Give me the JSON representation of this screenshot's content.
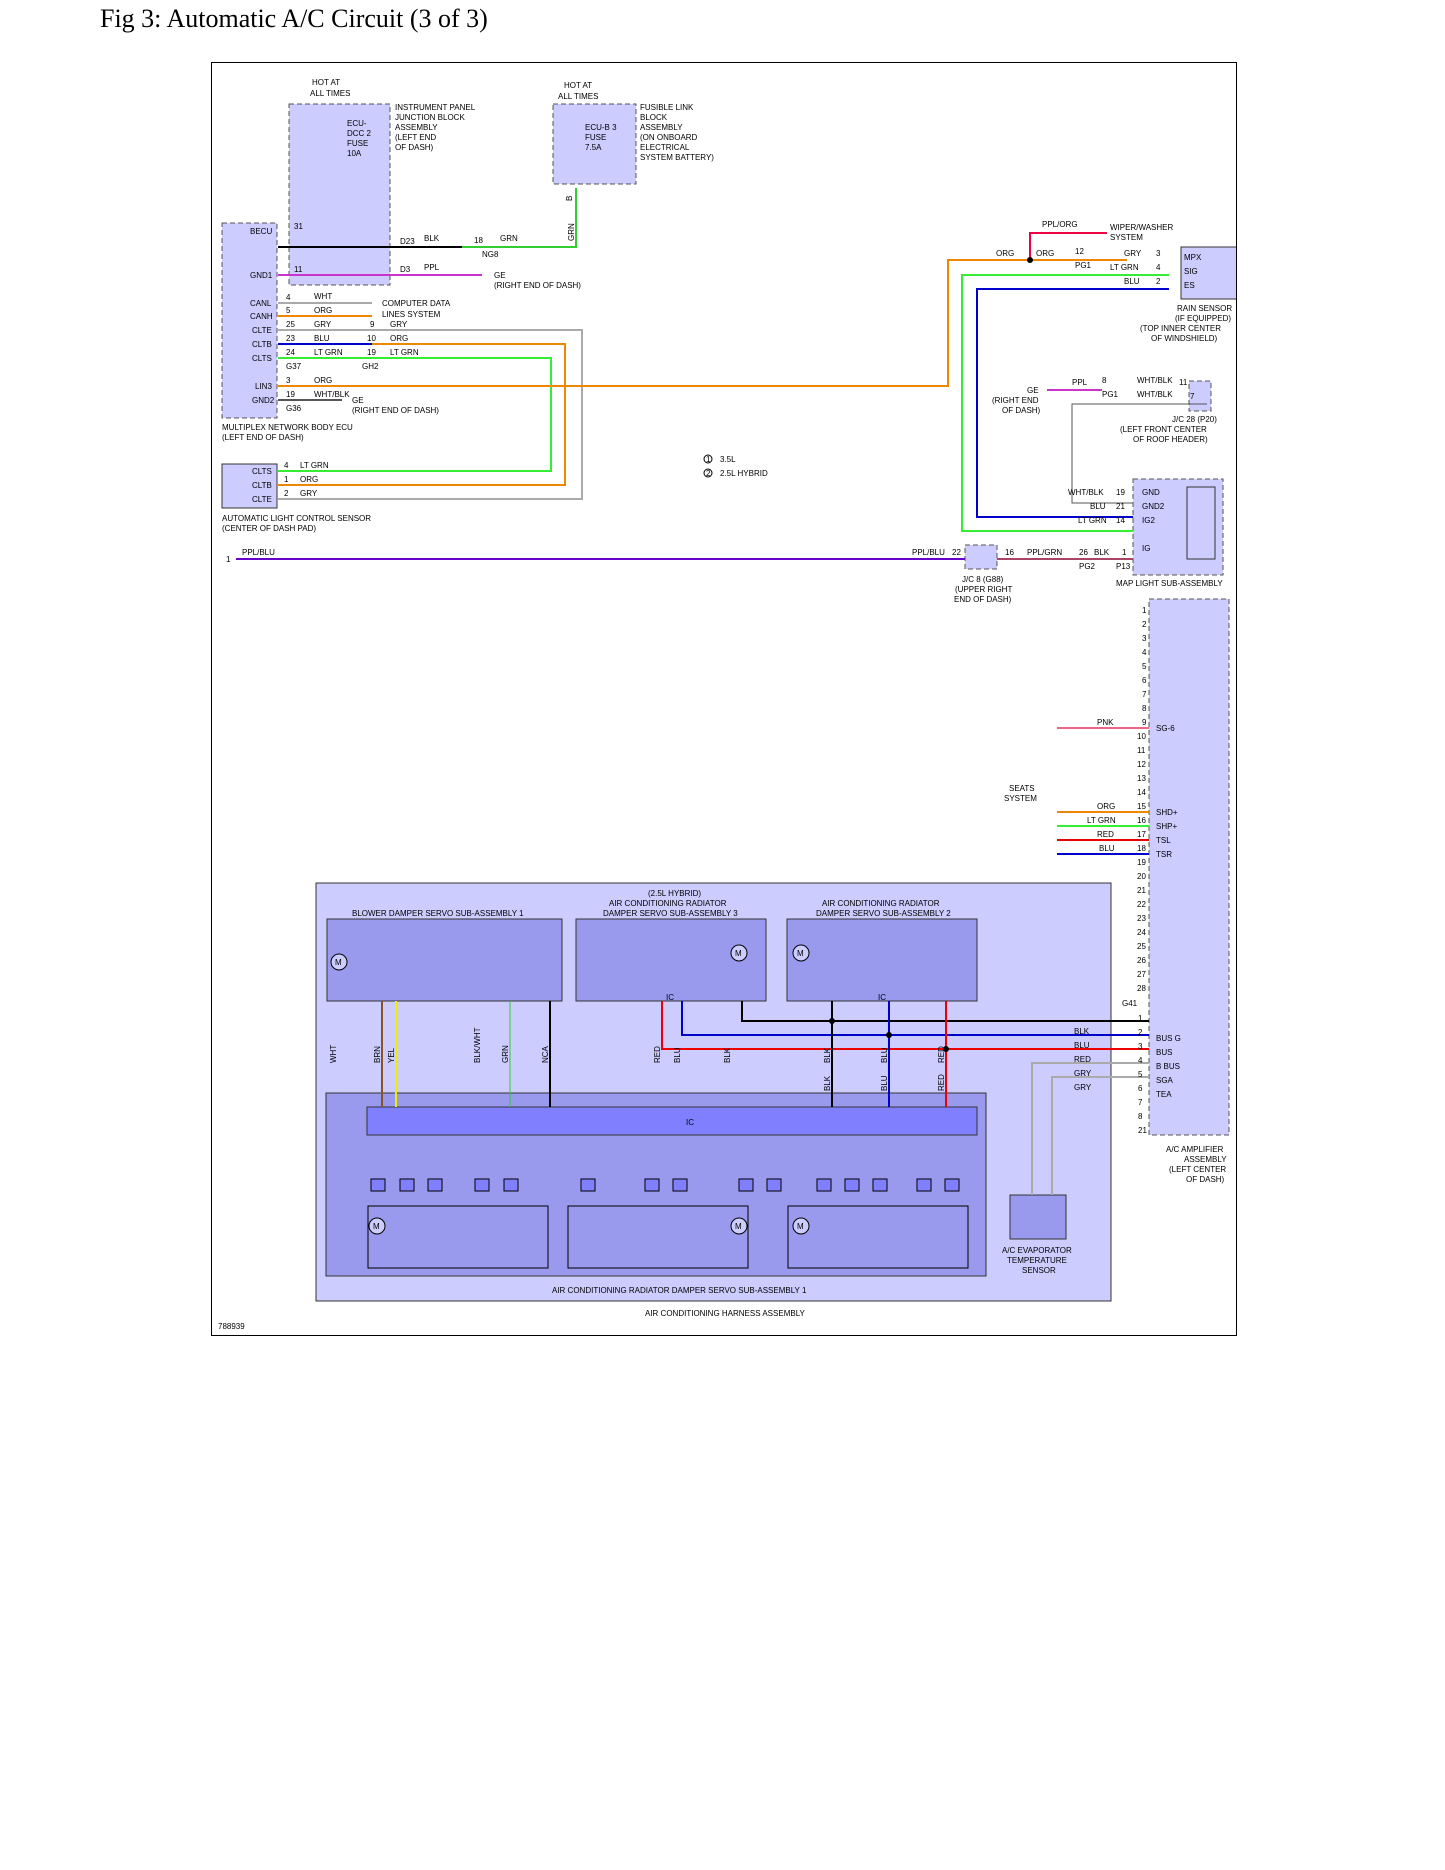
{
  "title": "Fig 3: Automatic A/C Circuit (3 of 3)",
  "colors": {
    "box": "#ccccff",
    "box_dark": "#9999ee",
    "ic": "#8080ff",
    "blk": "#000000",
    "grn": "#33cc33",
    "ppl": "#cc33cc",
    "org": "#ee8800",
    "gry": "#aaaaaa",
    "blu": "#0000cc",
    "ltgrn": "#33ee33",
    "red": "#ee0000",
    "yel": "#eeee00",
    "pnk": "#ee6688",
    "pplblu": "#6600cc"
  },
  "labels": {
    "hot1_a": "HOT AT",
    "hot1_b": "ALL TIMES",
    "hot2_a": "HOT AT",
    "hot2_b": "ALL TIMES",
    "ipjb": [
      "INSTRUMENT PANEL",
      "JUNCTION BLOCK",
      "ASSEMBLY",
      "(LEFT END",
      "OF DASH)"
    ],
    "ecu_dcc": [
      "ECU-",
      "DCC 2",
      "FUSE",
      "10A"
    ],
    "flb": [
      "FUSIBLE LINK",
      "BLOCK",
      "ASSEMBLY",
      "(ON ONBOARD",
      "ELECTRICAL",
      "SYSTEM BATTERY)"
    ],
    "ecu_b3": [
      "ECU-B 3",
      "FUSE",
      "7.5A"
    ],
    "w_b": "B",
    "w_grn_v": "GRN",
    "becu": "BECU",
    "gnd1": "GND1",
    "canl": "CANL",
    "canh": "CANH",
    "clte": "CLTE",
    "cltb": "CLTB",
    "clts": "CLTS",
    "lin3": "LIN3",
    "gnd2": "GND2",
    "p31": "31",
    "p11": "11",
    "p4": "4",
    "p5": "5",
    "p25": "25",
    "p23": "23",
    "p24": "24",
    "p3": "3",
    "p19": "19",
    "g37": "G37",
    "g36": "G36",
    "gh2": "GH2",
    "d23": "D23",
    "d3": "D3",
    "ng8": "NG8",
    "w_blk": "BLK",
    "w_18": "18",
    "w_grn": "GRN",
    "w_ppl": "PPL",
    "ge_a": "GE",
    "ge_a2": "(RIGHT END OF DASH)",
    "w_wht": "WHT",
    "w_org": "ORG",
    "w_gry": "GRY",
    "w_blu": "BLU",
    "w_ltgrn": "LT GRN",
    "w_org2": "ORG",
    "w_whtblk": "WHT/BLK",
    "cdl1": "COMPUTER DATA",
    "cdl2": "LINES SYSTEM",
    "j9": "9",
    "j10": "10",
    "j19": "19",
    "jgry": "GRY",
    "jorg": "ORG",
    "jltgrn": "LT GRN",
    "ge_b": "GE",
    "ge_b2": "(RIGHT END OF DASH)",
    "mpx_ecu1": "MULTIPLEX NETWORK BODY ECU",
    "mpx_ecu2": "(LEFT END OF DASH)",
    "als_clts": "CLTS",
    "als_cltb": "CLTB",
    "als_clte": "CLTE",
    "als_4": "4",
    "als_1": "1",
    "als_2": "2",
    "als_ltgrn": "LT GRN",
    "als_org": "ORG",
    "als_gry": "GRY",
    "als1": "AUTOMATIC LIGHT CONTROL SENSOR",
    "als2": "(CENTER OF DASH PAD)",
    "leg1_n": "1",
    "leg1": "3.5L",
    "leg2_n": "2",
    "leg2": "2.5L HYBRID",
    "pplorg": "PPL/ORG",
    "wiper1": "WIPER/WASHER",
    "wiper2": "SYSTEM",
    "rs_org": "ORG",
    "rs_org2": "ORG",
    "rs_12": "12",
    "rs_pg1": "PG1",
    "rs_gry": "GRY",
    "rs_3": "3",
    "rs_ltgrn": "LT GRN",
    "rs_4": "4",
    "rs_blu": "BLU",
    "rs_2": "2",
    "rs_mpx": "MPX",
    "rs_sig": "SIG",
    "rs_es": "ES",
    "rs1": "RAIN SENSOR",
    "rs2": "(IF EQUIPPED)",
    "rs3": "(TOP INNER CENTER",
    "rs4": "OF WINDSHIELD)",
    "ge_c": "GE",
    "ge_c2": "(RIGHT END",
    "ge_c3": "OF DASH)",
    "jc_ppl": "PPL",
    "jc_8": "8",
    "jc_pg1": "PG1",
    "jc_wb1": "WHT/BLK",
    "jc_wb2": "WHT/BLK",
    "jc_11": "11",
    "jc_7": "7",
    "jc28a": "J/C 28 (P20)",
    "jc28b": "(LEFT FRONT CENTER",
    "jc28c": "OF ROOF HEADER)",
    "ml_wb": "WHT/BLK",
    "ml_19": "19",
    "ml_blu": "BLU",
    "ml_21": "21",
    "ml_ltgrn": "LT GRN",
    "ml_14": "14",
    "ml_gnd": "GND",
    "ml_gnd2": "GND2",
    "ml_ig2": "IG2",
    "ml_ig": "IG",
    "pb_1": "1",
    "pb_pplblu": "PPL/BLU",
    "pb_pplblu2": "PPL/BLU",
    "pb_22": "22",
    "pb_16": "16",
    "pb_pplgrn": "PPL/GRN",
    "pb_26": "26",
    "pb_blk": "BLK",
    "pb_1b": "1",
    "pb_pg2": "PG2",
    "pb_p13": "P13",
    "jc8a": "J/C 8 (G88)",
    "jc8b": "(UPPER RIGHT",
    "jc8c": "END OF DASH)",
    "ml1": "MAP LIGHT SUB-ASSEMBLY",
    "seats1": "SEATS",
    "seats2": "SYSTEM",
    "s_pnk": "PNK",
    "s_org": "ORG",
    "s_ltgrn": "LT GRN",
    "s_red": "RED",
    "s_blu": "BLU",
    "sg6": "SG-6",
    "shd": "SHD+",
    "shp": "SHP+",
    "tsl": "TSL",
    "tsr": "TSR",
    "busg": "BUS G",
    "bus": "BUS",
    "bbus": "B BUS",
    "sga": "SGA",
    "tea": "TEA",
    "g41": "G41",
    "b_blk": "BLK",
    "b_blu": "BLU",
    "b_red": "RED",
    "b_gry": "GRY",
    "b_gry2": "GRY",
    "acamp1": "A/C AMPLIFIER",
    "acamp2": "ASSEMBLY",
    "acamp3": "(LEFT CENTER",
    "acamp4": "OF DASH)",
    "hyb": "(2.5L HYBRID)",
    "ds3a": "AIR CONDITIONING RADIATOR",
    "ds3b": "DAMPER SERVO SUB-ASSEMBLY 3",
    "ds2a": "AIR CONDITIONING RADIATOR",
    "ds2b": "DAMPER SERVO SUB-ASSEMBLY 2",
    "bds1": "BLOWER DAMPER SERVO SUB-ASSEMBLY 1",
    "ic1": "IC",
    "ic2": "IC",
    "ic3": "IC",
    "v_wht": "WHT",
    "v_brn": "BRN",
    "v_yel": "YEL",
    "v_blkwht": "BLK/WHT",
    "v_grn": "GRN",
    "v_nca": "NCA",
    "v_red": "RED",
    "v_blu": "BLU",
    "v_blk": "BLK",
    "v_blk2": "BLK",
    "v_blu2": "BLU",
    "v_red2": "RED",
    "v_blk3": "BLK",
    "v_blu3": "BLU",
    "v_red3": "RED",
    "evap1": "A/C EVAPORATOR",
    "evap2": "TEMPERATURE",
    "evap3": "SENSOR",
    "ds1": "AIR CONDITIONING RADIATOR DAMPER SERVO SUB-ASSEMBLY 1",
    "harness": "AIR CONDITIONING HARNESS ASSEMBLY",
    "m": "M",
    "fig_id": "788939"
  },
  "amp_pins_upper": [
    "1",
    "2",
    "3",
    "4",
    "5",
    "6",
    "7",
    "8",
    "9",
    "10",
    "11",
    "12",
    "13",
    "14",
    "15",
    "16",
    "17",
    "18",
    "19",
    "20",
    "21",
    "22",
    "23",
    "24",
    "25",
    "26",
    "27",
    "28"
  ],
  "amp_pins_lower": [
    "1",
    "2",
    "3",
    "4",
    "5",
    "6",
    "7",
    "8",
    "21"
  ]
}
